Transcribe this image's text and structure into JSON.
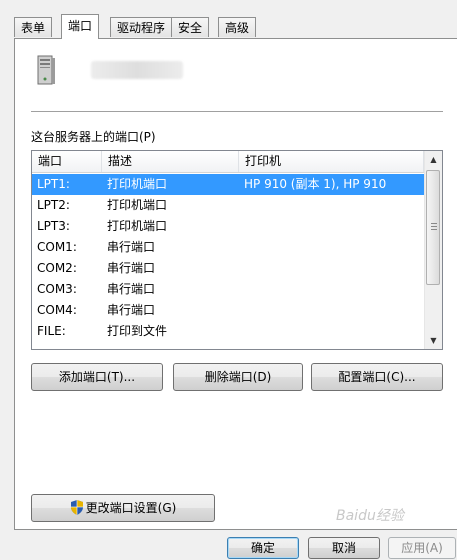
{
  "tabs": [
    {
      "label": "表单",
      "active": false
    },
    {
      "label": "端口",
      "active": true
    },
    {
      "label": "驱动程序",
      "active": false
    },
    {
      "label": "安全",
      "active": false
    },
    {
      "label": "高级",
      "active": false
    }
  ],
  "server": {
    "icon": "server-icon"
  },
  "ports": {
    "label": "这台服务器上的端口(P)",
    "columns": [
      "端口",
      "描述",
      "打印机"
    ],
    "rows": [
      {
        "port": "LPT1:",
        "description": "打印机端口",
        "printer": "HP 910 (副本 1), HP 910",
        "selected": true
      },
      {
        "port": "LPT2:",
        "description": "打印机端口",
        "printer": ""
      },
      {
        "port": "LPT3:",
        "description": "打印机端口",
        "printer": ""
      },
      {
        "port": "COM1:",
        "description": "串行端口",
        "printer": ""
      },
      {
        "port": "COM2:",
        "description": "串行端口",
        "printer": ""
      },
      {
        "port": "COM3:",
        "description": "串行端口",
        "printer": ""
      },
      {
        "port": "COM4:",
        "description": "串行端口",
        "printer": ""
      },
      {
        "port": "FILE:",
        "description": "打印到文件",
        "printer": ""
      }
    ]
  },
  "buttons": {
    "add_port": "添加端口(T)...",
    "delete_port": "删除端口(D)",
    "configure_port": "配置端口(C)...",
    "change_port_settings": "更改端口设置(G)"
  },
  "dialog_buttons": {
    "ok": "确定",
    "cancel": "取消",
    "apply": "应用(A)"
  },
  "watermark": "Baidu经验",
  "colors": {
    "selection": "#3399ff",
    "accent_border": "#3c7fb1"
  }
}
